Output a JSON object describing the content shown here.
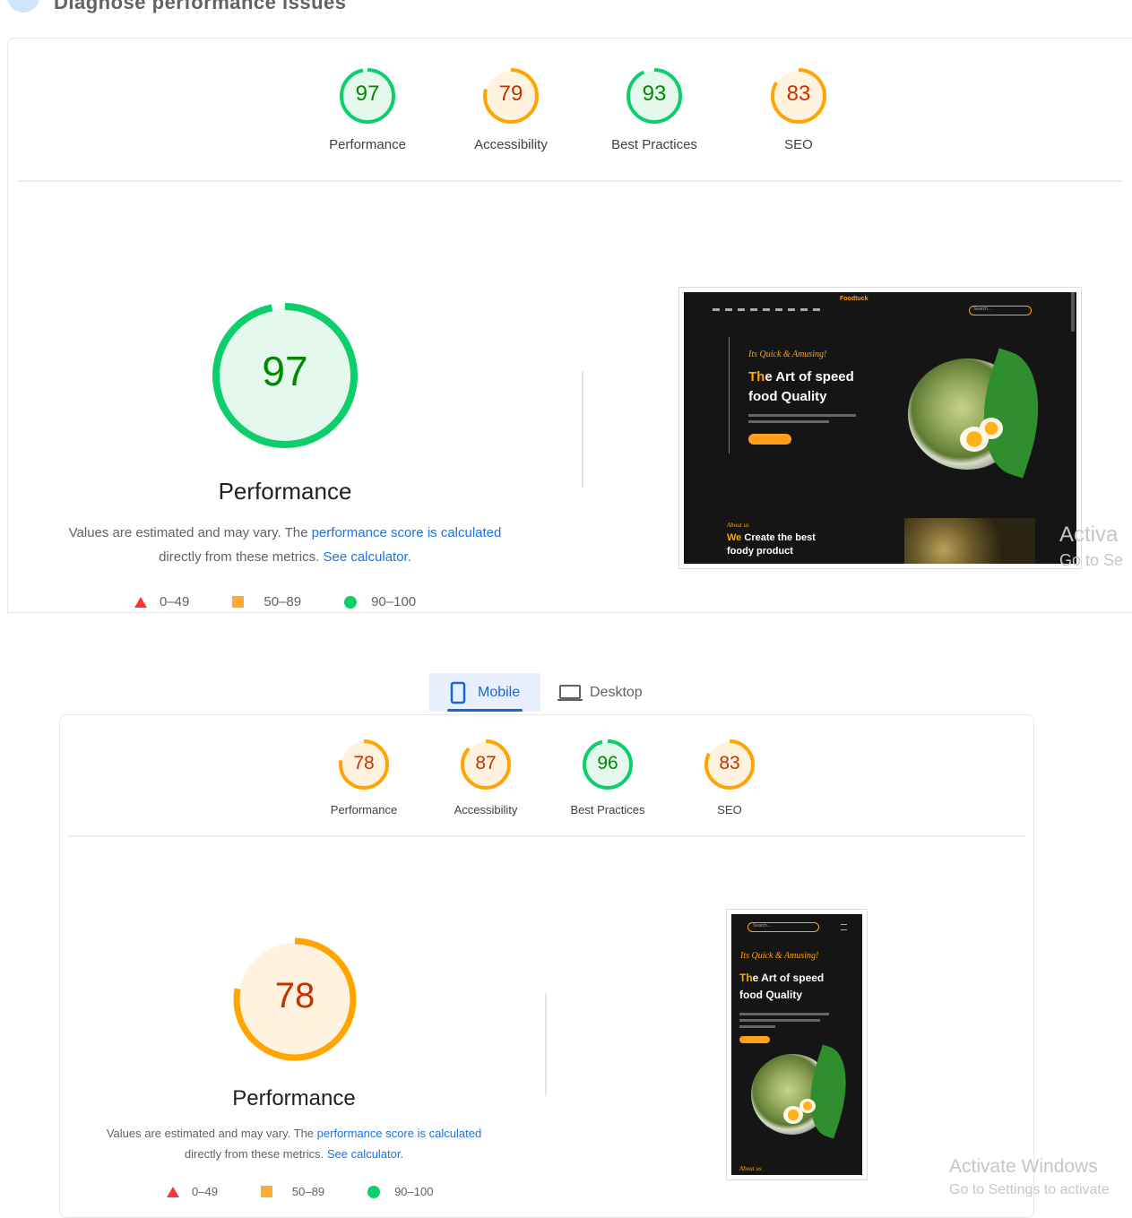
{
  "header": {
    "title": "Diagnose performance issues"
  },
  "desktop_report": {
    "scores": [
      {
        "value": "97",
        "label": "Performance",
        "status": "pass"
      },
      {
        "value": "79",
        "label": "Accessibility",
        "status": "average"
      },
      {
        "value": "93",
        "label": "Best Practices",
        "status": "pass"
      },
      {
        "value": "83",
        "label": "SEO",
        "status": "average"
      }
    ],
    "main_score": "97",
    "main_label": "Performance",
    "desc_prefix": "Values are estimated and may vary. The ",
    "desc_link1": "performance score is calculated",
    "desc_mid": "directly from these metrics. ",
    "desc_link2": "See calculator.",
    "legend": [
      "0–49",
      "50–89",
      "90–100"
    ],
    "screenshot": {
      "brand": "Foodtuck",
      "tagline": "Its Quick & Amusing!",
      "headline_orange": "Th",
      "headline_rest": "e Art of speed",
      "headline_line2": "food Quality",
      "section_tag": "About us",
      "section_orange": "We",
      "section_rest": " Create the best",
      "section_line2": "foody product",
      "search": "Search..."
    }
  },
  "tabs": [
    {
      "label": "Mobile",
      "icon": "mobile-icon",
      "active": true
    },
    {
      "label": "Desktop",
      "icon": "laptop-icon",
      "active": false
    }
  ],
  "mobile_report": {
    "scores": [
      {
        "value": "78",
        "label": "Performance",
        "status": "average"
      },
      {
        "value": "87",
        "label": "Accessibility",
        "status": "average"
      },
      {
        "value": "96",
        "label": "Best Practices",
        "status": "pass"
      },
      {
        "value": "83",
        "label": "SEO",
        "status": "average"
      }
    ],
    "main_score": "78",
    "main_label": "Performance",
    "desc_prefix": "Values are estimated and may vary. The ",
    "desc_link1": "performance score is calculated",
    "desc_mid": "directly from these metrics. ",
    "desc_link2": "See calculator.",
    "legend": [
      "0–49",
      "50–89",
      "90–100"
    ],
    "screenshot": {
      "search": "Search...",
      "tagline": "Its Quick & Amusing!",
      "headline_orange": "Th",
      "headline_rest": "e Art of speed",
      "headline_line2": "food Quality",
      "section_tag": "About us"
    }
  },
  "watermark": {
    "top_line1": "Activa",
    "top_line2": "Go to Se",
    "bottom_line1": "Activate Windows",
    "bottom_line2": "Go to Settings to activate"
  },
  "colors": {
    "pass": "#0cce6b",
    "average": "#ffa400",
    "fail": "#ff4e42",
    "pass_text": "#008800",
    "average_text": "#c33300",
    "link": "#1a73e8"
  }
}
